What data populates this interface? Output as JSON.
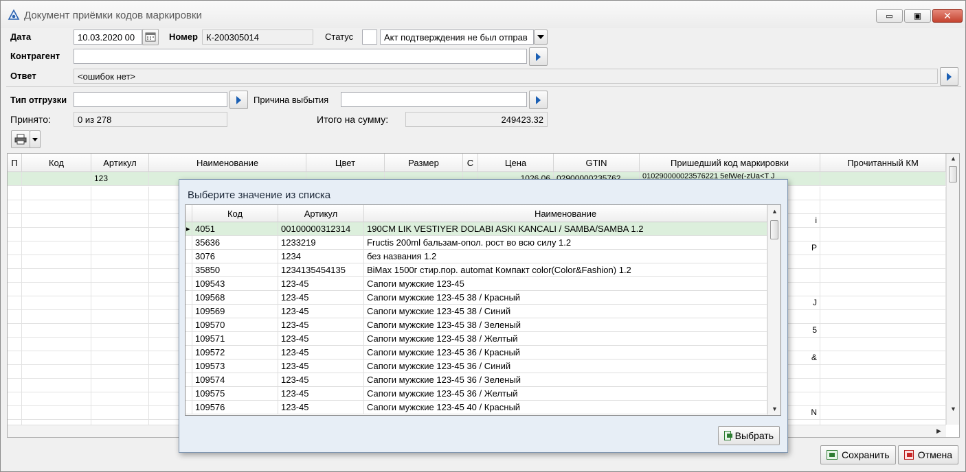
{
  "window": {
    "title": "Документ приёмки кодов маркировки",
    "minimize": "▭",
    "maximize": "▣",
    "close": "✕"
  },
  "header": {
    "date_label": "Дата",
    "date_value": "10.03.2020 00",
    "number_label": "Номер",
    "number_value": "К-200305014",
    "status_label": "Статус",
    "status_value": "Акт подтверждения не был отправ",
    "counterparty_label": "Контрагент",
    "counterparty_value": "",
    "answer_label": "Ответ",
    "answer_value": "<ошибок нет>",
    "shipment_type_label": "Тип отгрузки",
    "shipment_type_value": "",
    "retire_reason_label": "Причина выбытия",
    "retire_reason_value": "",
    "accepted_label": "Принято:",
    "accepted_value": "0 из 278",
    "total_label": "Итого на сумму:",
    "total_value": "249423.32"
  },
  "grid": {
    "columns": [
      "П",
      "Код",
      "Артикул",
      "Наименование",
      "Цвет",
      "Размер",
      "С",
      "Цена",
      "GTIN",
      "Пришедший код маркировки",
      "Прочитанный КМ"
    ],
    "first_row": {
      "article": "123",
      "price": "1026.06",
      "gtin": "02900000235762",
      "code": "010290000023576221 5elWe(-zUa<T J"
    },
    "visible_code_fragments": [
      "i",
      "P",
      "J",
      "5",
      "&",
      "N"
    ]
  },
  "popup": {
    "title": "Выберите значение из списка",
    "columns": [
      "Код",
      "Артикул",
      "Наименование"
    ],
    "rows": [
      {
        "code": "4051",
        "article": "00100000312314",
        "name": "190CM LIK VESTIYER DOLABI ASKI KANCALI / SAMBA/SAMBA 1.2"
      },
      {
        "code": "35636",
        "article": "1233219",
        "name": "Fructis 200ml бальзам-опол. рост во всю силу 1.2"
      },
      {
        "code": "3076",
        "article": "1234",
        "name": "без названия 1.2"
      },
      {
        "code": "35850",
        "article": "1234135454135",
        "name": "BiMax 1500г стир.пор. automat Компакт color(Color&Fashion) 1.2"
      },
      {
        "code": "109543",
        "article": "123-45",
        "name": "Сапоги мужские 123-45"
      },
      {
        "code": "109568",
        "article": "123-45",
        "name": "Сапоги мужские 123-45 38 / Красный"
      },
      {
        "code": "109569",
        "article": "123-45",
        "name": "Сапоги мужские 123-45 38 / Синий"
      },
      {
        "code": "109570",
        "article": "123-45",
        "name": "Сапоги мужские 123-45 38 / Зеленый"
      },
      {
        "code": "109571",
        "article": "123-45",
        "name": "Сапоги мужские 123-45 38 / Желтый"
      },
      {
        "code": "109572",
        "article": "123-45",
        "name": "Сапоги мужские 123-45 36 / Красный"
      },
      {
        "code": "109573",
        "article": "123-45",
        "name": "Сапоги мужские 123-45 36 / Синий"
      },
      {
        "code": "109574",
        "article": "123-45",
        "name": "Сапоги мужские 123-45 36 / Зеленый"
      },
      {
        "code": "109575",
        "article": "123-45",
        "name": "Сапоги мужские 123-45 36 / Желтый"
      },
      {
        "code": "109576",
        "article": "123-45",
        "name": "Сапоги мужские 123-45 40 / Красный"
      }
    ],
    "select_label": "Выбрать"
  },
  "footer": {
    "save_label": "Сохранить",
    "cancel_label": "Отмена"
  },
  "colors": {
    "selected_row": "#dcefdc",
    "accent_arrow": "#1a5fb4",
    "popup_bg": "#e7eef6"
  }
}
